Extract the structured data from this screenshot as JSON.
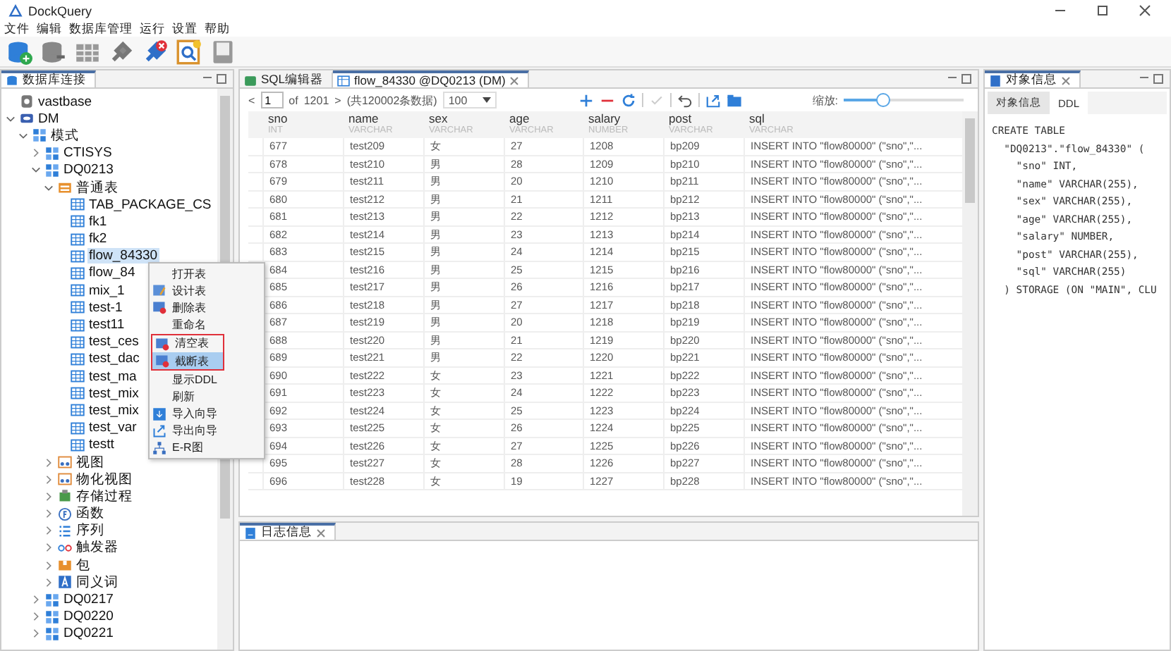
{
  "window": {
    "title": "DockQuery"
  },
  "menu": [
    "文件",
    "编辑",
    "数据库管理",
    "运行",
    "设置",
    "帮助"
  ],
  "toolbar": [
    {
      "kind": "db-add"
    },
    {
      "kind": "db-link"
    },
    {
      "kind": "grid"
    },
    {
      "kind": "plug"
    },
    {
      "kind": "plug-off"
    },
    {
      "kind": "sql"
    },
    {
      "kind": "save"
    }
  ],
  "left_panel": {
    "tab": "数据库连接",
    "tree": [
      {
        "label": "vastbase",
        "kind": "server",
        "selected": false
      },
      {
        "label": "DM",
        "kind": "db",
        "expanded": true,
        "selected": false,
        "children": [
          {
            "label": "模式",
            "kind": "schema",
            "expanded": true,
            "selected": false,
            "children": [
              {
                "label": "CTISYS",
                "kind": "schema",
                "expanded": false,
                "selected": false
              },
              {
                "label": "DQ0213",
                "kind": "schema",
                "expanded": true,
                "selected": false,
                "children": [
                  {
                    "label": "普通表",
                    "kind": "folder",
                    "expanded": true,
                    "selected": false,
                    "children": [
                      {
                        "label": "TAB_PACKAGE_CS",
                        "kind": "table",
                        "selected": false
                      },
                      {
                        "label": "fk1",
                        "kind": "table",
                        "selected": false
                      },
                      {
                        "label": "fk2",
                        "kind": "table",
                        "selected": false
                      },
                      {
                        "label": "flow_84330",
                        "kind": "table",
                        "selected": true
                      },
                      {
                        "label": "flow_84",
                        "kind": "table",
                        "selected": false
                      },
                      {
                        "label": "mix_1",
                        "kind": "table",
                        "selected": false
                      },
                      {
                        "label": "test-1",
                        "kind": "table",
                        "selected": false
                      },
                      {
                        "label": "test11",
                        "kind": "table",
                        "selected": false
                      },
                      {
                        "label": "test_ces",
                        "kind": "table",
                        "selected": false
                      },
                      {
                        "label": "test_dac",
                        "kind": "table",
                        "selected": false
                      },
                      {
                        "label": "test_ma",
                        "kind": "table",
                        "selected": false
                      },
                      {
                        "label": "test_mix",
                        "kind": "table",
                        "selected": false
                      },
                      {
                        "label": "test_mix",
                        "kind": "table",
                        "selected": false
                      },
                      {
                        "label": "test_var",
                        "kind": "table",
                        "selected": false
                      },
                      {
                        "label": "testt",
                        "kind": "table",
                        "selected": false
                      }
                    ]
                  },
                  {
                    "label": "视图",
                    "kind": "view",
                    "expanded": false,
                    "selected": false
                  },
                  {
                    "label": "物化视图",
                    "kind": "view",
                    "expanded": false,
                    "selected": false
                  },
                  {
                    "label": "存储过程",
                    "kind": "proc",
                    "expanded": false,
                    "selected": false
                  },
                  {
                    "label": "函数",
                    "kind": "func",
                    "expanded": false,
                    "selected": false
                  },
                  {
                    "label": "序列",
                    "kind": "seq",
                    "expanded": false,
                    "selected": false
                  },
                  {
                    "label": "触发器",
                    "kind": "trigger",
                    "expanded": false,
                    "selected": false
                  },
                  {
                    "label": "包",
                    "kind": "pkg",
                    "expanded": false,
                    "selected": false
                  },
                  {
                    "label": "同义词",
                    "kind": "synonym",
                    "expanded": false,
                    "selected": false
                  }
                ]
              },
              {
                "label": "DQ0217",
                "kind": "schema",
                "expanded": false,
                "selected": false
              },
              {
                "label": "DQ0220",
                "kind": "schema",
                "expanded": false,
                "selected": false
              },
              {
                "label": "DQ0221",
                "kind": "schema",
                "expanded": false,
                "selected": false
              }
            ]
          }
        ]
      }
    ]
  },
  "context_menu": [
    {
      "label": "打开表",
      "kind": "plain",
      "selected": false,
      "marked": false
    },
    {
      "label": "设计表",
      "kind": "design",
      "selected": false,
      "marked": false
    },
    {
      "label": "删除表",
      "kind": "table-red",
      "selected": false,
      "marked": false
    },
    {
      "label": "重命名",
      "kind": "plain",
      "selected": false,
      "marked": false
    },
    {
      "label": "清空表",
      "kind": "table-red",
      "selected": false,
      "marked": true
    },
    {
      "label": "截断表",
      "kind": "table-red",
      "selected": true,
      "marked": true
    },
    {
      "label": "显示DDL",
      "kind": "plain",
      "selected": false,
      "marked": false
    },
    {
      "label": "刷新",
      "kind": "plain",
      "selected": false,
      "marked": false
    },
    {
      "label": "导入向导",
      "kind": "import",
      "selected": false,
      "marked": false
    },
    {
      "label": "导出向导",
      "kind": "export",
      "selected": false,
      "marked": false
    },
    {
      "label": "E-R图",
      "kind": "diagram",
      "selected": false,
      "marked": false
    }
  ],
  "editor_tabs": [
    {
      "label": "SQL编辑器",
      "kind": "sql",
      "selected": false,
      "closable": false
    },
    {
      "label": "flow_84330 @DQ0213 (DM)",
      "kind": "table",
      "selected": true,
      "closable": true
    }
  ],
  "pager": {
    "prev": "<",
    "page": "1",
    "of": "of",
    "total_pages": "1201",
    "next": ">",
    "count": "(共120002条数据)",
    "page_size": "100"
  },
  "grid_actions": [
    {
      "kind": "add",
      "disabled": false
    },
    {
      "kind": "remove",
      "disabled": false
    },
    {
      "kind": "refresh",
      "disabled": false
    },
    {
      "kind": "commit",
      "disabled": true
    },
    {
      "kind": "undo",
      "disabled": false
    },
    {
      "kind": "export",
      "disabled": false
    },
    {
      "kind": "folder",
      "disabled": false
    }
  ],
  "zoom": {
    "label": "缩放:",
    "level": 0.33
  },
  "table": {
    "columns": [
      {
        "name": "sno",
        "type": "INT"
      },
      {
        "name": "name",
        "type": "VARCHAR"
      },
      {
        "name": "sex",
        "type": "VARCHAR"
      },
      {
        "name": "age",
        "type": "VARCHAR"
      },
      {
        "name": "salary",
        "type": "NUMBER"
      },
      {
        "name": "post",
        "type": "VARCHAR"
      },
      {
        "name": "sql",
        "type": "VARCHAR"
      }
    ],
    "rows": [
      [
        "677",
        "test209",
        "女",
        "27",
        "1208",
        "bp209",
        "INSERT INTO \"flow80000\" (\"sno\",\"..."
      ],
      [
        "678",
        "test210",
        "男",
        "28",
        "1209",
        "bp210",
        "INSERT INTO \"flow80000\" (\"sno\",\"..."
      ],
      [
        "679",
        "test211",
        "男",
        "20",
        "1210",
        "bp211",
        "INSERT INTO \"flow80000\" (\"sno\",\"..."
      ],
      [
        "680",
        "test212",
        "男",
        "21",
        "1211",
        "bp212",
        "INSERT INTO \"flow80000\" (\"sno\",\"..."
      ],
      [
        "681",
        "test213",
        "男",
        "22",
        "1212",
        "bp213",
        "INSERT INTO \"flow80000\" (\"sno\",\"..."
      ],
      [
        "682",
        "test214",
        "男",
        "23",
        "1213",
        "bp214",
        "INSERT INTO \"flow80000\" (\"sno\",\"..."
      ],
      [
        "683",
        "test215",
        "男",
        "24",
        "1214",
        "bp215",
        "INSERT INTO \"flow80000\" (\"sno\",\"..."
      ],
      [
        "684",
        "test216",
        "男",
        "25",
        "1215",
        "bp216",
        "INSERT INTO \"flow80000\" (\"sno\",\"..."
      ],
      [
        "685",
        "test217",
        "男",
        "26",
        "1216",
        "bp217",
        "INSERT INTO \"flow80000\" (\"sno\",\"..."
      ],
      [
        "686",
        "test218",
        "男",
        "27",
        "1217",
        "bp218",
        "INSERT INTO \"flow80000\" (\"sno\",\"..."
      ],
      [
        "687",
        "test219",
        "男",
        "20",
        "1218",
        "bp219",
        "INSERT INTO \"flow80000\" (\"sno\",\"..."
      ],
      [
        "688",
        "test220",
        "男",
        "21",
        "1219",
        "bp220",
        "INSERT INTO \"flow80000\" (\"sno\",\"..."
      ],
      [
        "689",
        "test221",
        "男",
        "22",
        "1220",
        "bp221",
        "INSERT INTO \"flow80000\" (\"sno\",\"..."
      ],
      [
        "690",
        "test222",
        "女",
        "23",
        "1221",
        "bp222",
        "INSERT INTO \"flow80000\" (\"sno\",\"..."
      ],
      [
        "691",
        "test223",
        "女",
        "24",
        "1222",
        "bp223",
        "INSERT INTO \"flow80000\" (\"sno\",\"..."
      ],
      [
        "692",
        "test224",
        "女",
        "25",
        "1223",
        "bp224",
        "INSERT INTO \"flow80000\" (\"sno\",\"..."
      ],
      [
        "693",
        "test225",
        "女",
        "26",
        "1224",
        "bp225",
        "INSERT INTO \"flow80000\" (\"sno\",\"..."
      ],
      [
        "694",
        "test226",
        "女",
        "27",
        "1225",
        "bp226",
        "INSERT INTO \"flow80000\" (\"sno\",\"..."
      ],
      [
        "695",
        "test227",
        "女",
        "28",
        "1226",
        "bp227",
        "INSERT INTO \"flow80000\" (\"sno\",\"..."
      ],
      [
        "696",
        "test228",
        "女",
        "19",
        "1227",
        "bp228",
        "INSERT INTO \"flow80000\" (\"sno\",\"..."
      ]
    ]
  },
  "log_panel": {
    "tab": "日志信息"
  },
  "right_panel": {
    "tab": "对象信息",
    "subtabs": [
      {
        "label": "对象信息",
        "selected": false
      },
      {
        "label": "DDL",
        "selected": true
      }
    ],
    "ddl": [
      "CREATE TABLE",
      "  \"DQ0213\".\"flow_84330\" (",
      "    \"sno\" INT,",
      "    \"name\" VARCHAR(255),",
      "    \"sex\" VARCHAR(255),",
      "    \"age\" VARCHAR(255),",
      "    \"salary\" NUMBER,",
      "    \"post\" VARCHAR(255),",
      "    \"sql\" VARCHAR(255)",
      "  ) STORAGE (ON \"MAIN\", CLU"
    ]
  }
}
